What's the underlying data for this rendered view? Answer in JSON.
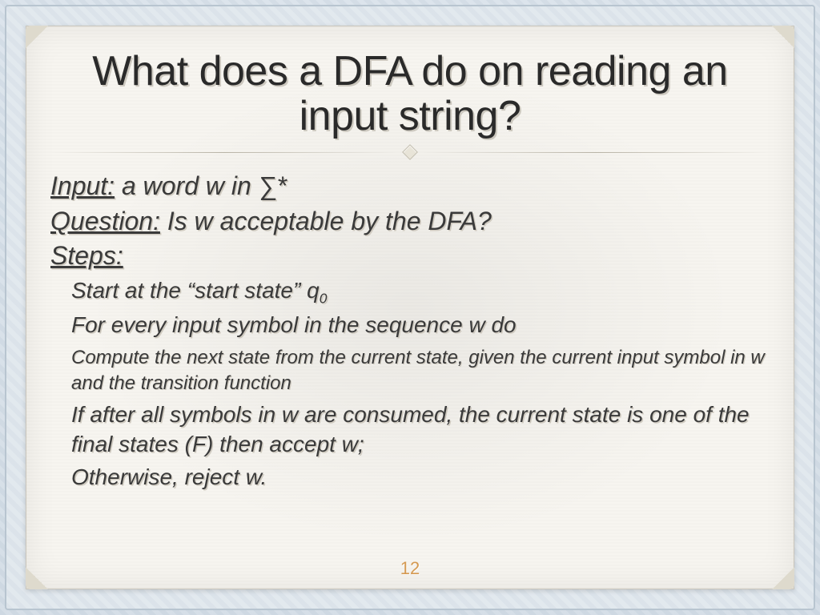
{
  "title": "What does a DFA do on reading an input string?",
  "input": {
    "label": "Input:",
    "text": " a word w in ∑*"
  },
  "question": {
    "label": "Question:",
    "text": " Is w acceptable by the DFA?"
  },
  "steps_label": "Steps:",
  "steps": {
    "s1_pre": "Start at the “start state” q",
    "s1_sub": "0",
    "s2": "For every input symbol in the sequence w do",
    "s2a": "Compute the next state from the current state, given the current input symbol in w and the transition function",
    "s3": "If after all symbols in w are consumed, the current state is one of the final states (F) then accept w;",
    "s4": "Otherwise, reject w."
  },
  "page_number": "12"
}
